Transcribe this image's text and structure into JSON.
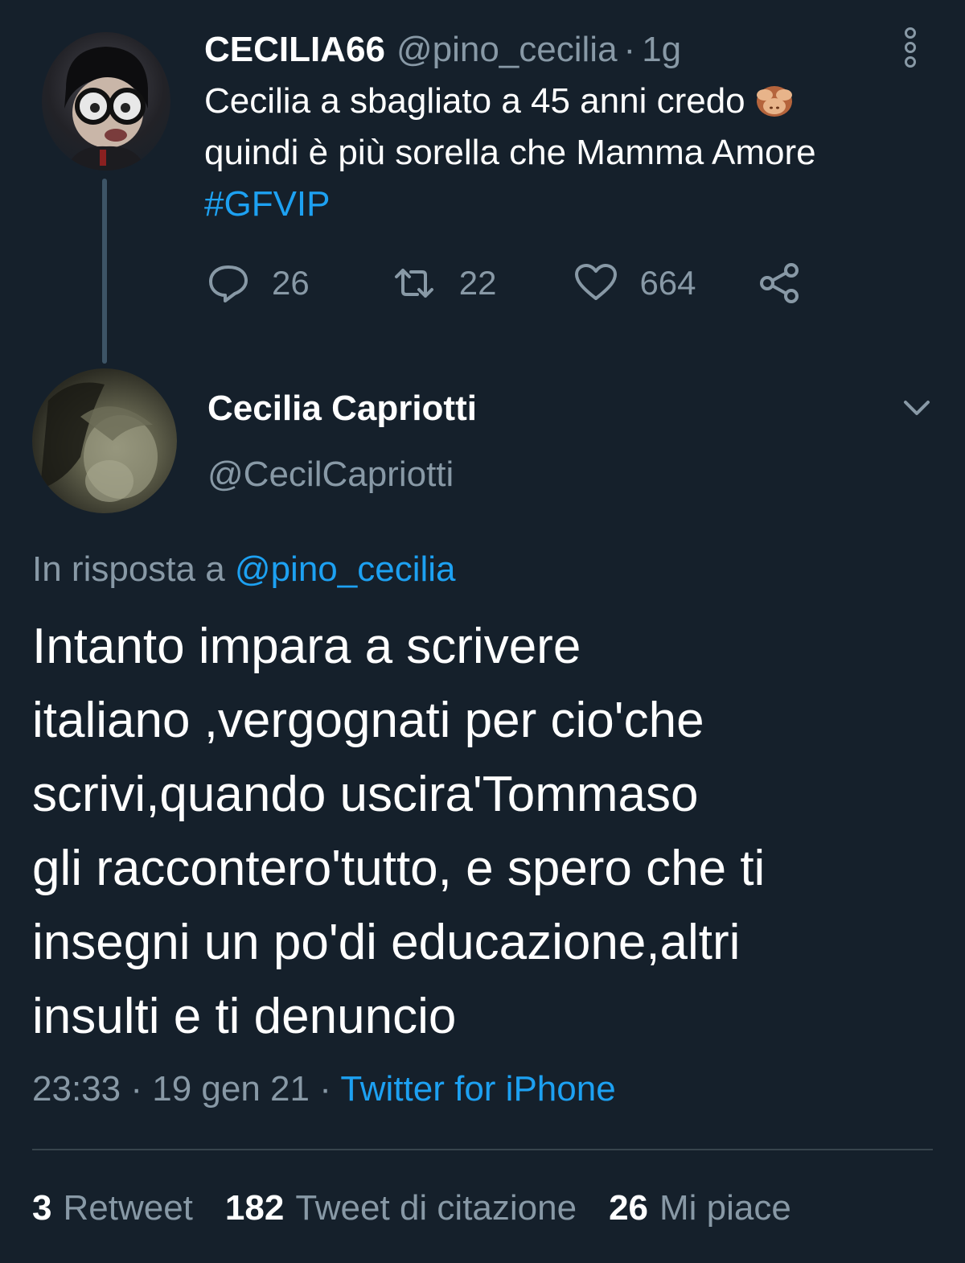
{
  "colors": {
    "background": "#15202b",
    "primary_text": "#ffffff",
    "secondary_text": "#8899a6",
    "link": "#1da1f2",
    "divider": "#38444d"
  },
  "parent_tweet": {
    "display_name": "CECILIA66",
    "handle": "@pino_cecilia",
    "separator": "·",
    "time": "1g",
    "text_line1": "Cecilia a sbagliato a 45 anni credo",
    "emoji_icon": "see-no-evil-monkey-icon",
    "text_line2": "quindi è più sorella che Mamma Amore",
    "hashtag": "#GFVIP",
    "actions": {
      "reply_count": "26",
      "retweet_count": "22",
      "like_count": "664"
    }
  },
  "main_tweet": {
    "display_name": "Cecilia Capriotti",
    "handle": "@CecilCapriotti",
    "reply_prefix": "In risposta a",
    "reply_mention": "@pino_cecilia",
    "body_lines": [
      "Intanto impara a scrivere",
      "italiano ,vergognati per cio'che",
      "scrivi,quando uscira'Tommaso",
      "gli raccontero'tutto, e spero che ti",
      "insegni un po'di educazione,altri",
      "insulti e ti denuncio"
    ],
    "time": "23:33",
    "separator": "·",
    "date": "19 gen 21",
    "source": "Twitter for iPhone",
    "stats": {
      "retweets": "3",
      "retweets_label": "Retweet",
      "quotes": "182",
      "quotes_label": "Tweet di citazione",
      "likes": "26",
      "likes_label": "Mi piace"
    }
  }
}
